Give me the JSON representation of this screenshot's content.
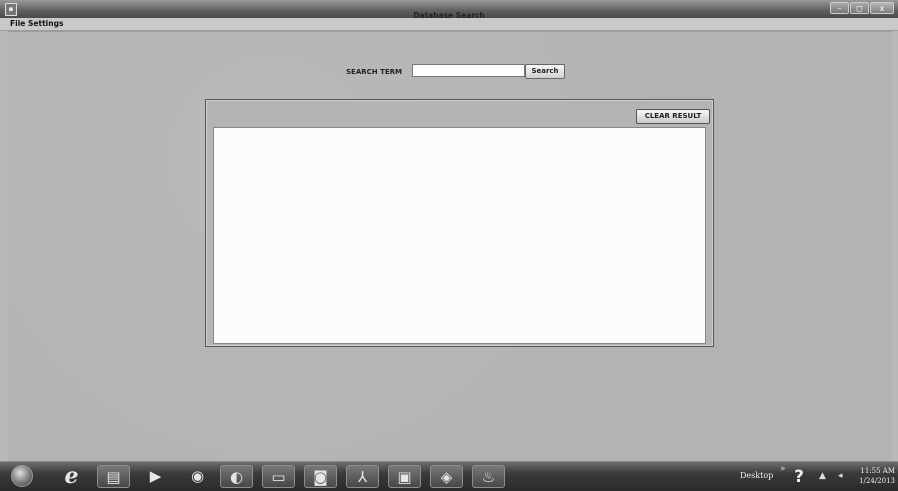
{
  "window": {
    "app_icon": "app-window-icon",
    "controls": {
      "minimize_glyph": "–",
      "maximize_glyph": "◻",
      "close_glyph": "x"
    }
  },
  "menu": {
    "items": [
      {
        "label": "File"
      },
      {
        "label": "Settings"
      }
    ]
  },
  "main": {
    "title": "Database Search",
    "search": {
      "label": "SEARCH TERM",
      "value": "",
      "placeholder": "",
      "button_label": "Search"
    },
    "results": {
      "clear_button_label": "CLEAR RESULT",
      "content": ""
    }
  },
  "taskbar": {
    "icons": [
      {
        "name": "start-orb-icon"
      },
      {
        "name": "internet-explorer-icon",
        "glyph": "e"
      },
      {
        "name": "file-explorer-icon",
        "glyph": "▤"
      },
      {
        "name": "media-player-icon",
        "glyph": "▶"
      },
      {
        "name": "disc-icon",
        "glyph": "◉"
      },
      {
        "name": "browser-globe-icon",
        "glyph": "◐"
      },
      {
        "name": "printer-icon",
        "glyph": "▭"
      },
      {
        "name": "camera-icon",
        "glyph": "◙"
      },
      {
        "name": "pdf-reader-icon",
        "glyph": "⅄"
      },
      {
        "name": "chart-app-icon",
        "glyph": "▣"
      },
      {
        "name": "package-icon",
        "glyph": "◈"
      },
      {
        "name": "java-app-icon",
        "glyph": "♨"
      }
    ],
    "desktop_label": "Desktop",
    "tray_chevron": "»",
    "help_glyph": "?",
    "tray_up_glyph": "▲",
    "tray_dot_glyph": "◂",
    "clock": {
      "time": "11:55 AM",
      "date": "1/24/2013"
    }
  },
  "colors": {
    "background": "#b8b8b8",
    "results_area": "#fcfcfc",
    "taskbar": "#2a2a2a"
  }
}
